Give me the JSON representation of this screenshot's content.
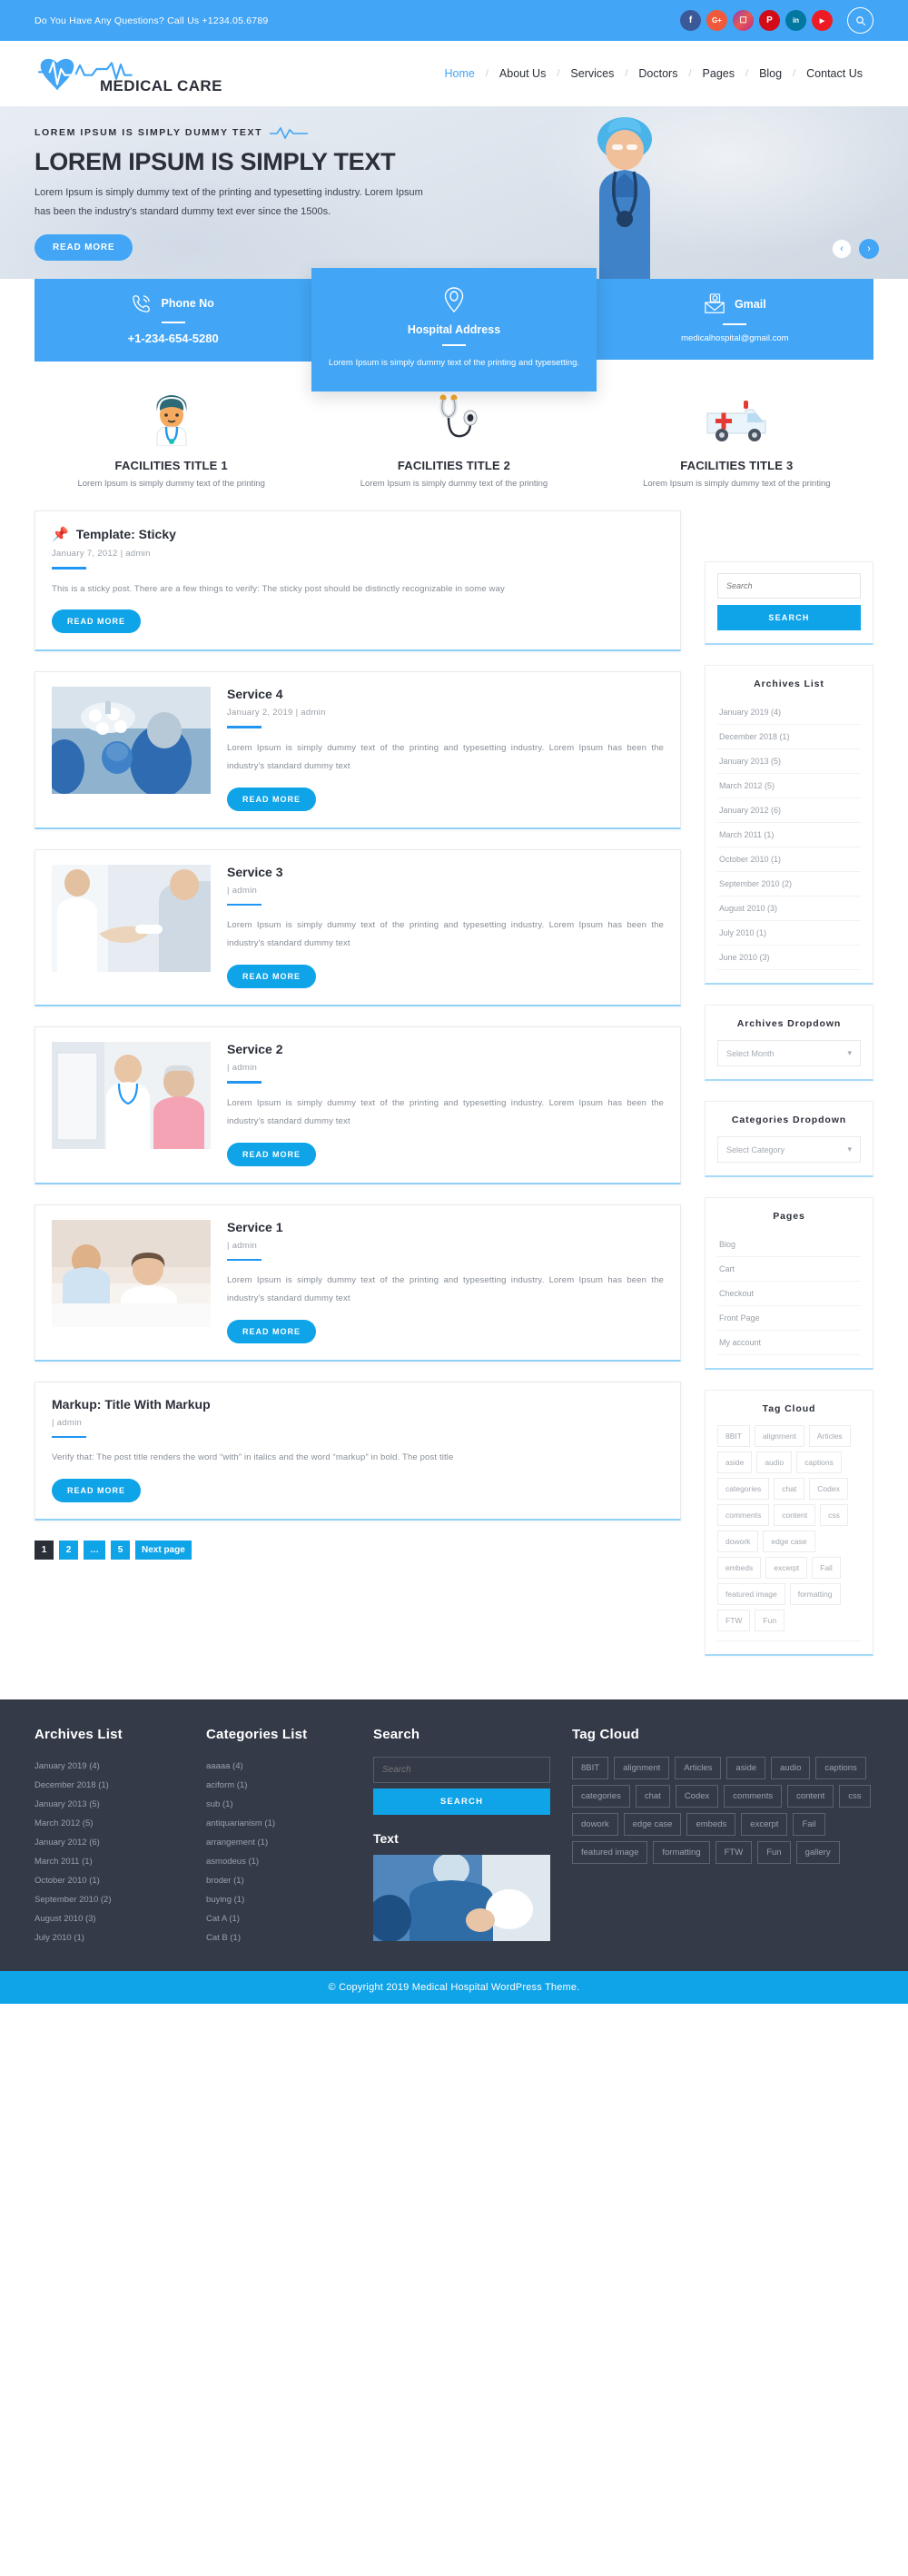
{
  "topbar": {
    "contact_text": "Do You Have Any Questions? Call Us +1234.05.6789",
    "socials": [
      {
        "name": "facebook",
        "glyph": "f"
      },
      {
        "name": "google-plus",
        "glyph": "G+"
      },
      {
        "name": "instagram",
        "glyph": "▣"
      },
      {
        "name": "pinterest",
        "glyph": "P"
      },
      {
        "name": "linkedin",
        "glyph": "in"
      },
      {
        "name": "youtube",
        "glyph": "▶"
      }
    ]
  },
  "header": {
    "logo_text": "MEDICAL CARE",
    "nav": [
      {
        "label": "Home",
        "active": true
      },
      {
        "label": "About Us",
        "active": false
      },
      {
        "label": "Services",
        "active": false
      },
      {
        "label": "Doctors",
        "active": false
      },
      {
        "label": "Pages",
        "active": false
      },
      {
        "label": "Blog",
        "active": false
      },
      {
        "label": "Contact Us",
        "active": false
      }
    ]
  },
  "hero": {
    "kicker": "LOREM IPSUM IS SIMPLY DUMMY TEXT",
    "title": "LOREM IPSUM IS SIMPLY TEXT",
    "description": "Lorem Ipsum is simply dummy text of the printing and typesetting industry. Lorem Ipsum has been the industry's standard dummy text ever since the 1500s.",
    "button": "READ MORE",
    "prev_label": "‹",
    "next_label": "›"
  },
  "info_boxes": [
    {
      "icon": "phone-icon",
      "title": "Phone No",
      "value": "+1-234-654-5280",
      "small": false
    },
    {
      "icon": "location-pin-icon",
      "title": "Hospital Address",
      "value": "Lorem Ipsum is simply dummy text of the printing and typesetting.",
      "small": true
    },
    {
      "icon": "envelope-at-icon",
      "title": "Gmail",
      "value": "medicalhospital@gmail.com",
      "small": true
    }
  ],
  "facilities": [
    {
      "icon": "doctor-avatar-icon",
      "title": "FACILITIES TITLE 1",
      "desc": "Lorem Ipsum is simply dummy text of the printing"
    },
    {
      "icon": "stethoscope-icon",
      "title": "FACILITIES TITLE 2",
      "desc": "Lorem Ipsum is simply dummy text of the printing"
    },
    {
      "icon": "ambulance-icon",
      "title": "FACILITIES TITLE 3",
      "desc": "Lorem Ipsum is simply dummy text of the printing"
    }
  ],
  "posts": [
    {
      "title": "Template: Sticky",
      "sticky": true,
      "pin": "📌",
      "meta": "January 7, 2012  |  admin",
      "text": "This is a sticky post. There are a few things to verify: The sticky post should be distinctly recognizable in some way",
      "button": "READ MORE",
      "thumb": null
    },
    {
      "title": "Service 4",
      "sticky": false,
      "meta": "January 2, 2019 |  admin",
      "text": "Lorem Ipsum is simply dummy text of the printing and typesetting industry. Lorem Ipsum has been the industry's standard dummy text",
      "button": "READ MORE",
      "thumb": "operating-room-photo"
    },
    {
      "title": "Service 3",
      "sticky": false,
      "meta": "|  admin",
      "text": "Lorem Ipsum is simply dummy text of the printing and typesetting industry. Lorem Ipsum has been the industry's standard dummy text",
      "button": "READ MORE",
      "thumb": "doctor-handshake-photo"
    },
    {
      "title": "Service 2",
      "sticky": false,
      "meta": "|  admin",
      "text": "Lorem Ipsum is simply dummy text of the printing and typesetting industry. Lorem Ipsum has been the industry's standard dummy text",
      "button": "READ MORE",
      "thumb": "doctor-patient-photo"
    },
    {
      "title": "Service 1",
      "sticky": false,
      "meta": "|  admin",
      "text": "Lorem Ipsum is simply dummy text of the printing and typesetting industry. Lorem Ipsum has been the industry's standard dummy text",
      "button": "READ MORE",
      "thumb": "hospital-bed-photo"
    },
    {
      "title": "Markup: Title With Markup",
      "sticky": false,
      "meta": "|  admin",
      "text": "Verify that: The post title renders the word “with” in italics and the word “markup” in bold. The post title",
      "button": "READ MORE",
      "thumb": null
    }
  ],
  "pagination": [
    {
      "label": "1",
      "current": true
    },
    {
      "label": "2",
      "current": false
    },
    {
      "label": "…",
      "current": false
    },
    {
      "label": "5",
      "current": false
    },
    {
      "label": "Next page",
      "current": false
    }
  ],
  "sidebar": {
    "search": {
      "placeholder": "Search",
      "button": "SEARCH"
    },
    "archives_title": "Archives List",
    "archives": [
      "January 2019 (4)",
      "December 2018 (1)",
      "January 2013 (5)",
      "March 2012 (5)",
      "January 2012 (6)",
      "March 2011 (1)",
      "October 2010 (1)",
      "September 2010 (2)",
      "August 2010 (3)",
      "July 2010 (1)",
      "June 2010 (3)"
    ],
    "archives_dropdown_title": "Archives Dropdown",
    "archives_dropdown_value": "Select Month",
    "categories_dropdown_title": "Categories Dropdown",
    "categories_dropdown_value": "Select Category",
    "pages_title": "Pages",
    "pages": [
      "Blog",
      "Cart",
      "Checkout",
      "Front Page",
      "My account"
    ],
    "tagcloud_title": "Tag Cloud",
    "tags": [
      "8BIT",
      "alignment",
      "Articles",
      "aside",
      "audio",
      "captions",
      "categories",
      "chat",
      "Codex",
      "comments",
      "content",
      "css",
      "dowork",
      "edge case",
      "embeds",
      "excerpt",
      "Fail",
      "featured image",
      "formatting",
      "FTW",
      "Fun"
    ]
  },
  "footer": {
    "archives_title": "Archives List",
    "archives": [
      "January 2019 (4)",
      "December 2018 (1)",
      "January 2013 (5)",
      "March 2012 (5)",
      "January 2012 (6)",
      "March 2011 (1)",
      "October 2010 (1)",
      "September 2010 (2)",
      "August 2010 (3)",
      "July 2010 (1)"
    ],
    "categories_title": "Categories List",
    "categories": [
      "aaaaa (4)",
      "aciform (1)",
      "sub (1)",
      "antiquarianism (1)",
      "arrangement (1)",
      "asmodeus (1)",
      "broder (1)",
      "buying (1)",
      "Cat A (1)",
      "Cat B (1)"
    ],
    "search_title": "Search",
    "search_placeholder": "Search",
    "search_button": "SEARCH",
    "text_title": "Text",
    "text_image": "surgery-photo",
    "tagcloud_title": "Tag Cloud",
    "tags": [
      "8BIT",
      "alignment",
      "Articles",
      "aside",
      "audio",
      "captions",
      "categories",
      "chat",
      "Codex",
      "comments",
      "content",
      "css",
      "dowork",
      "edge case",
      "embeds",
      "excerpt",
      "Fail",
      "featured image",
      "formatting",
      "FTW",
      "Fun",
      "gallery"
    ],
    "copyright": "© Copyright 2019 Medical Hospital WordPress Theme."
  },
  "colors": {
    "brand_blue": "#42a5f5",
    "accent_blue": "#0fa3e8",
    "footer_dark": "#343a47"
  }
}
